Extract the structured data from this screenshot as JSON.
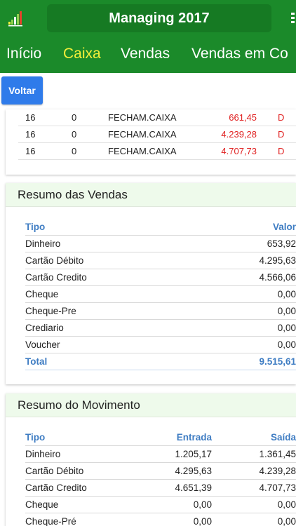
{
  "header": {
    "title": "Managing 2017",
    "logo_icon": "bar-chart-logo-icon",
    "menu_icon": "kebab-menu-icon"
  },
  "tabs": [
    {
      "label": "Início",
      "active": false
    },
    {
      "label": "Caixa",
      "active": true
    },
    {
      "label": "Vendas",
      "active": false
    },
    {
      "label": "Vendas em Co",
      "active": false
    }
  ],
  "voltar_label": "Voltar",
  "movements": [
    {
      "col1": "16",
      "col2": "0",
      "desc": "FECHAM.CAIXA",
      "value": "661,45",
      "type": "D"
    },
    {
      "col1": "16",
      "col2": "0",
      "desc": "FECHAM.CAIXA",
      "value": "4.239,28",
      "type": "D"
    },
    {
      "col1": "16",
      "col2": "0",
      "desc": "FECHAM.CAIXA",
      "value": "4.707,73",
      "type": "D"
    }
  ],
  "resumo_vendas": {
    "title": "Resumo das Vendas",
    "headers": {
      "tipo": "Tipo",
      "valor": "Valor"
    },
    "rows": [
      {
        "tipo": "Dinheiro",
        "valor": "653,92"
      },
      {
        "tipo": "Cartão Débito",
        "valor": "4.295,63"
      },
      {
        "tipo": "Cartão Credito",
        "valor": "4.566,06"
      },
      {
        "tipo": "Cheque",
        "valor": "0,00"
      },
      {
        "tipo": "Cheque-Pre",
        "valor": "0,00"
      },
      {
        "tipo": "Crediario",
        "valor": "0,00"
      },
      {
        "tipo": "Voucher",
        "valor": "0,00"
      }
    ],
    "total": {
      "tipo": "Total",
      "valor": "9.515,61"
    }
  },
  "resumo_movimento": {
    "title": "Resumo do Movimento",
    "headers": {
      "tipo": "Tipo",
      "entrada": "Entrada",
      "saida": "Saída"
    },
    "rows": [
      {
        "tipo": "Dinheiro",
        "entrada": "1.205,17",
        "saida": "1.361,45"
      },
      {
        "tipo": "Cartão Débito",
        "entrada": "4.295,63",
        "saida": "4.239,28"
      },
      {
        "tipo": "Cartão Credito",
        "entrada": "4.651,39",
        "saida": "4.707,73"
      },
      {
        "tipo": "Cheque",
        "entrada": "0,00",
        "saida": "0,00"
      },
      {
        "tipo": "Cheque-Pré",
        "entrada": "0,00",
        "saida": "0,00"
      }
    ]
  },
  "colors": {
    "app_green": "#1b8a2a",
    "active_tab": "#f4ef3a",
    "button_blue": "#2f7bea",
    "header_blue": "#3f7dc3",
    "debit_red": "#e02020"
  }
}
